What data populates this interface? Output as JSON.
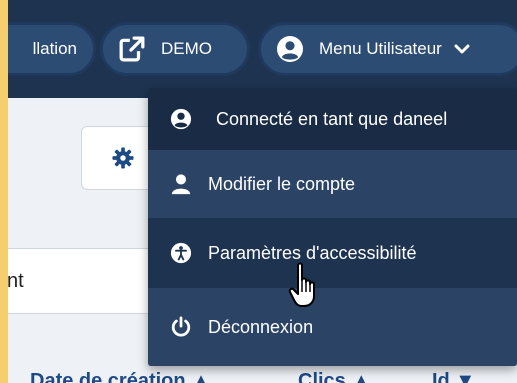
{
  "header": {
    "install_label": "llation",
    "demo_label": "DEMO",
    "user_menu_label": "Menu Utilisateur",
    "icons": {
      "demo": "external-link-icon",
      "user": "user-circle-icon",
      "chevron": "chevron-down-icon"
    }
  },
  "toolbar": {
    "gear_icon": "gear-icon"
  },
  "search": {
    "value": "nt"
  },
  "table": {
    "columns": [
      "Date de création ▲",
      "Clics ▲",
      "Id ▼"
    ]
  },
  "user_menu": {
    "items": [
      {
        "label": "Connecté en tant que daneel",
        "icon": "user-circle-icon"
      },
      {
        "label": "Modifier le compte",
        "icon": "user-icon"
      },
      {
        "label": "Paramètres d'accessibilité",
        "icon": "accessibility-icon"
      },
      {
        "label": "Déconnexion",
        "icon": "power-icon"
      }
    ]
  },
  "colors": {
    "outer_background": "#f5cf6e",
    "topbar": "#1d3350",
    "pill": "#2c4c74",
    "menu_hover": "#1d3350",
    "link_blue": "#1e4a86"
  }
}
